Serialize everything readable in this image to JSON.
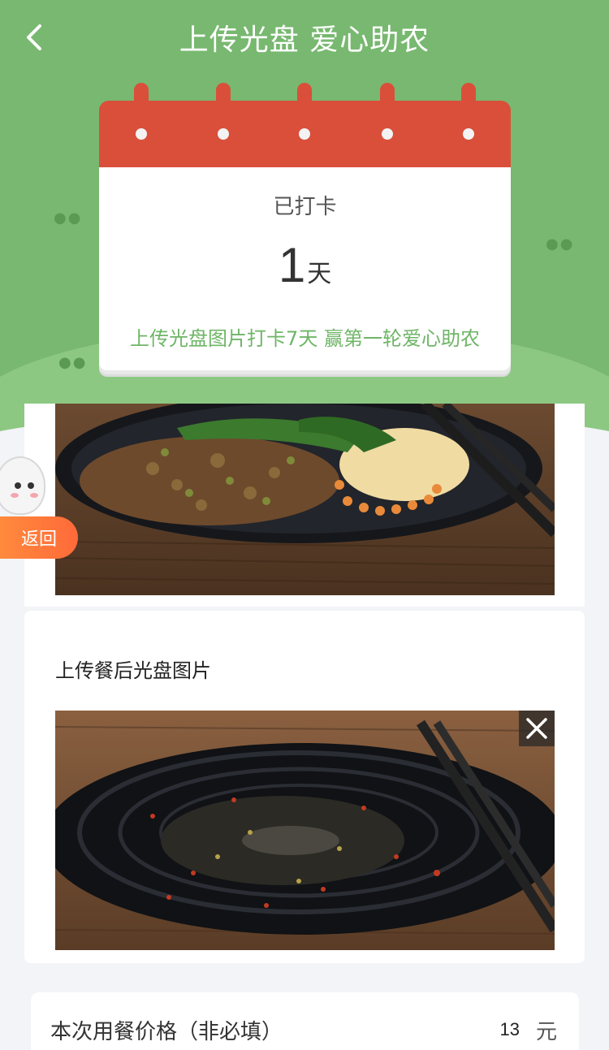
{
  "header": {
    "title": "上传光盘 爱心助农"
  },
  "calendar": {
    "checked_label": "已打卡",
    "days": "1",
    "days_unit": "天",
    "promo_text": "上传光盘图片打卡7天 赢第一轮爱心助农"
  },
  "float_button": {
    "label": "返回"
  },
  "upload": {
    "label": "上传餐后光盘图片"
  },
  "price": {
    "label": "本次用餐价格（非必填）",
    "value": "13",
    "unit": "元"
  },
  "colors": {
    "header_green": "#78b870",
    "calendar_red": "#d94f3a",
    "promo_green": "#6fb567",
    "float_orange": "#ff7a3a"
  },
  "icons": {
    "back": "chevron-left-icon",
    "close": "close-icon"
  }
}
